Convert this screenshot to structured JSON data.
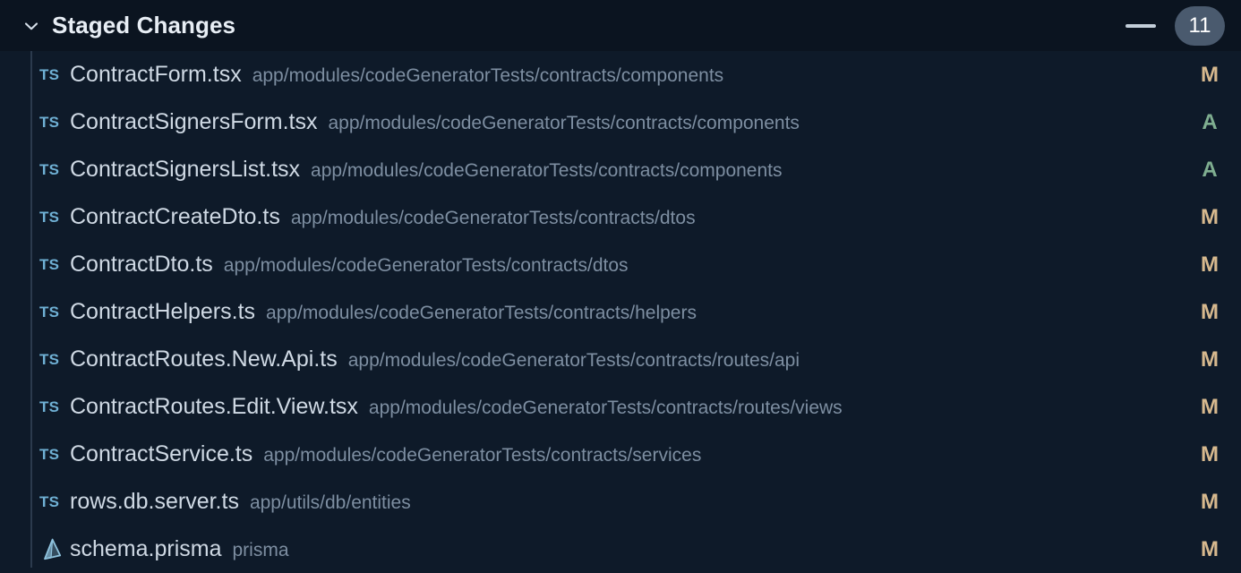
{
  "header": {
    "title": "Staged Changes",
    "chevron_icon": "chevron-down-icon",
    "minimize_icon": "minimize-icon",
    "badge_count": "11",
    "badge_color": "#4a5a6e"
  },
  "colors": {
    "background": "#0b1420",
    "list_background": "#0e1a29",
    "indent_guide": "#2b3a4d",
    "file_name": "#cfd9e4",
    "file_path": "#7d8ea1",
    "status_modified": "#d7b98e",
    "status_added": "#7fae90",
    "ts_icon": "#6fb0d4",
    "prisma_icon": "#8fc3de"
  },
  "files": [
    {
      "icon": "typescript-file-icon",
      "icon_label": "TS",
      "name": "ContractForm.tsx",
      "path": "app/modules/codeGeneratorTests/contracts/components",
      "status": "M"
    },
    {
      "icon": "typescript-file-icon",
      "icon_label": "TS",
      "name": "ContractSignersForm.tsx",
      "path": "app/modules/codeGeneratorTests/contracts/components",
      "status": "A"
    },
    {
      "icon": "typescript-file-icon",
      "icon_label": "TS",
      "name": "ContractSignersList.tsx",
      "path": "app/modules/codeGeneratorTests/contracts/components",
      "status": "A"
    },
    {
      "icon": "typescript-file-icon",
      "icon_label": "TS",
      "name": "ContractCreateDto.ts",
      "path": "app/modules/codeGeneratorTests/contracts/dtos",
      "status": "M"
    },
    {
      "icon": "typescript-file-icon",
      "icon_label": "TS",
      "name": "ContractDto.ts",
      "path": "app/modules/codeGeneratorTests/contracts/dtos",
      "status": "M"
    },
    {
      "icon": "typescript-file-icon",
      "icon_label": "TS",
      "name": "ContractHelpers.ts",
      "path": "app/modules/codeGeneratorTests/contracts/helpers",
      "status": "M"
    },
    {
      "icon": "typescript-file-icon",
      "icon_label": "TS",
      "name": "ContractRoutes.New.Api.ts",
      "path": "app/modules/codeGeneratorTests/contracts/routes/api",
      "status": "M"
    },
    {
      "icon": "typescript-file-icon",
      "icon_label": "TS",
      "name": "ContractRoutes.Edit.View.tsx",
      "path": "app/modules/codeGeneratorTests/contracts/routes/views",
      "status": "M"
    },
    {
      "icon": "typescript-file-icon",
      "icon_label": "TS",
      "name": "ContractService.ts",
      "path": "app/modules/codeGeneratorTests/contracts/services",
      "status": "M"
    },
    {
      "icon": "typescript-file-icon",
      "icon_label": "TS",
      "name": "rows.db.server.ts",
      "path": "app/utils/db/entities",
      "status": "M"
    },
    {
      "icon": "prisma-file-icon",
      "icon_label": "",
      "name": "schema.prisma",
      "path": "prisma",
      "status": "M"
    }
  ]
}
